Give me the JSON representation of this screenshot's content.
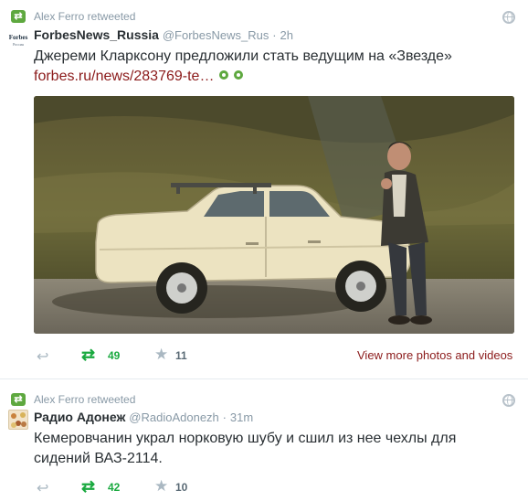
{
  "tweets": [
    {
      "retweeted_by": "Alex Ferro retweeted",
      "avatar_text": "Forbes",
      "avatar_sub": "Россия",
      "name": "ForbesNews_Russia",
      "handle": "@ForbesNews_Rus",
      "separator": "·",
      "time": "2h",
      "text": "Джереми Кларксону предложили стать ведущим на «Звезде»",
      "link": "forbes.ru/news/283769-te…",
      "retweet_count": "49",
      "favorite_count": "11",
      "more_link": "View more photos and videos"
    },
    {
      "retweeted_by": "Alex Ferro retweeted",
      "name": "Радио Адонеж",
      "handle": "@RadioAdonezh",
      "separator": "·",
      "time": "31m",
      "text_line1": "Кемеровчанин украл норковую шубу и сшил из нее чехлы для",
      "text_line2": "сидений ВАЗ-2114.",
      "retweet_count": "42",
      "favorite_count": "10"
    }
  ],
  "icons": {
    "retweeted": "retweet-icon",
    "globe": "globe-icon",
    "reply": "reply-icon",
    "retweet": "retweet-icon",
    "favorite": "star-icon",
    "link_preview": "media-dot-icon"
  },
  "colors": {
    "link": "#8b1a1a",
    "retweet_green": "#19a93f",
    "muted": "#8899a6",
    "text": "#292f33"
  }
}
